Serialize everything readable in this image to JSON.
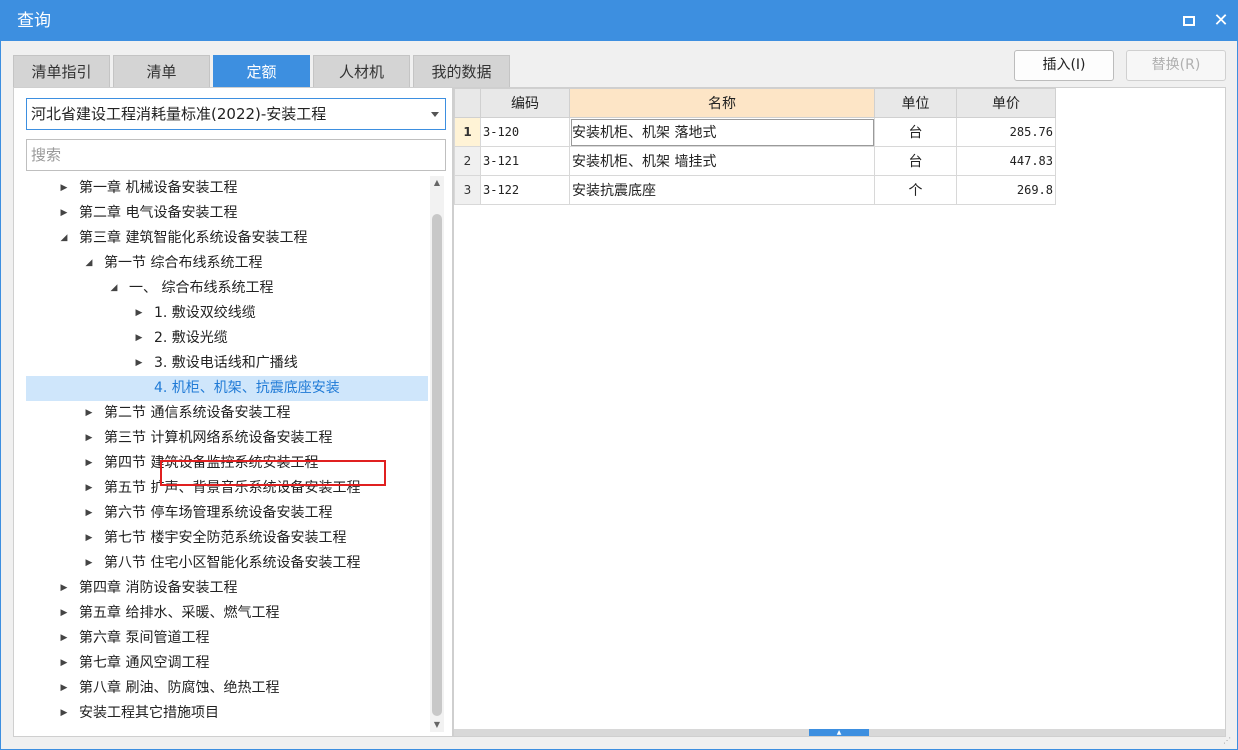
{
  "window": {
    "title": "查询",
    "maximize_icon": "maximize-icon",
    "close_icon": "close-icon",
    "close_glyph": "✕"
  },
  "tabs": [
    {
      "label": "清单指引",
      "active": false
    },
    {
      "label": "清单",
      "active": false
    },
    {
      "label": "定额",
      "active": true
    },
    {
      "label": "人材机",
      "active": false
    },
    {
      "label": "我的数据",
      "active": false
    }
  ],
  "actions": {
    "insert_label": "插入(I)",
    "replace_label": "替换(R)"
  },
  "left": {
    "library_select": "河北省建设工程消耗量标准(2022)-安装工程",
    "search_placeholder": "搜索",
    "tree": [
      {
        "label": "第一章 机械设备安装工程",
        "level": 0,
        "expanded": false
      },
      {
        "label": "第二章 电气设备安装工程",
        "level": 0,
        "expanded": false
      },
      {
        "label": "第三章 建筑智能化系统设备安装工程",
        "level": 0,
        "expanded": true
      },
      {
        "label": "第一节 综合布线系统工程",
        "level": 1,
        "expanded": true
      },
      {
        "label": "一、 综合布线系统工程",
        "level": 2,
        "expanded": true
      },
      {
        "label": "1. 敷设双绞线缆",
        "level": 3,
        "expanded": false
      },
      {
        "label": "2. 敷设光缆",
        "level": 3,
        "expanded": false
      },
      {
        "label": "3. 敷设电话线和广播线",
        "level": 3,
        "expanded": false
      },
      {
        "label": "4. 机柜、机架、抗震底座安装",
        "level": 3,
        "leaf": true,
        "selected": true
      },
      {
        "label": "第二节 通信系统设备安装工程",
        "level": 1,
        "expanded": false
      },
      {
        "label": "第三节 计算机网络系统设备安装工程",
        "level": 1,
        "expanded": false
      },
      {
        "label": "第四节 建筑设备监控系统安装工程",
        "level": 1,
        "expanded": false
      },
      {
        "label": "第五节 扩声、背景音乐系统设备安装工程",
        "level": 1,
        "expanded": false
      },
      {
        "label": "第六节 停车场管理系统设备安装工程",
        "level": 1,
        "expanded": false
      },
      {
        "label": "第七节 楼宇安全防范系统设备安装工程",
        "level": 1,
        "expanded": false
      },
      {
        "label": "第八节 住宅小区智能化系统设备安装工程",
        "level": 1,
        "expanded": false
      },
      {
        "label": "第四章 消防设备安装工程",
        "level": 0,
        "expanded": false
      },
      {
        "label": "第五章 给排水、采暖、燃气工程",
        "level": 0,
        "expanded": false
      },
      {
        "label": "第六章 泵间管道工程",
        "level": 0,
        "expanded": false
      },
      {
        "label": "第七章 通风空调工程",
        "level": 0,
        "expanded": false
      },
      {
        "label": "第八章 刷油、防腐蚀、绝热工程",
        "level": 0,
        "expanded": false
      },
      {
        "label": "安装工程其它措施项目",
        "level": 0,
        "expanded": false
      }
    ]
  },
  "grid": {
    "columns": [
      "编码",
      "名称",
      "单位",
      "单价"
    ],
    "rows": [
      {
        "num": "1",
        "code": "3-120",
        "name": "安装机柜、机架 落地式",
        "unit": "台",
        "price": "285.76"
      },
      {
        "num": "2",
        "code": "3-121",
        "name": "安装机柜、机架 墙挂式",
        "unit": "台",
        "price": "447.83"
      },
      {
        "num": "3",
        "code": "3-122",
        "name": "安装抗震底座",
        "unit": "个",
        "price": "269.8"
      }
    ]
  },
  "colors": {
    "accent": "#3d8fe0",
    "selected_row": "#cfe6fb",
    "highlight_border": "#e02020",
    "sorted_header": "#fde5c6"
  }
}
